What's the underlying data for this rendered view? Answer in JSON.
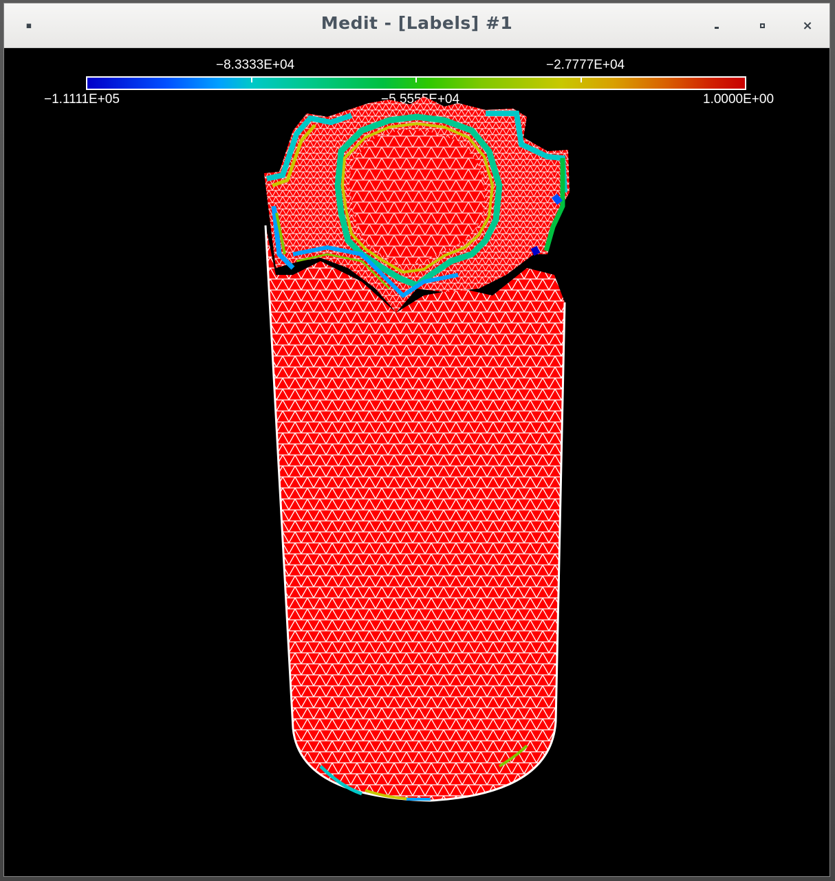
{
  "window": {
    "title": "Medit - [Labels] #1",
    "menu_icon": "window-menu-icon",
    "minimize_icon": "minimize-icon",
    "maximize_icon": "maximize-icon",
    "close_icon": "close-icon",
    "close_glyph": "×"
  },
  "colorbar": {
    "min_label": "−1.1111E+05",
    "mid_label": "−5.5555E+04",
    "max_label": "1.0000E+00",
    "upper_left_label": "−8.3333E+04",
    "upper_right_label": "−2.7777E+04",
    "colors": [
      "#0000c8",
      "#00a0ff",
      "#00c890",
      "#00c040",
      "#80c800",
      "#c8c800",
      "#d86000",
      "#c80000"
    ]
  },
  "scene": {
    "background_color": "#000000",
    "surface_color": "#ff0000",
    "wire_color": "#ffffff",
    "object": "tetrahedral cylinder mesh"
  }
}
